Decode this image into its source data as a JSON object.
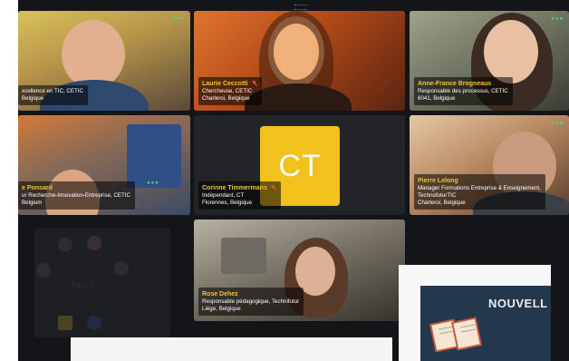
{
  "tiles": [
    {
      "name_label": "",
      "line1": "xcellence en TIC, CETIC",
      "line2": "Belgique"
    },
    {
      "name_label": "Laurie Ceccotti",
      "line1": "Chercheuse, CETIC",
      "line2": "Charleroi, Belgique"
    },
    {
      "name_label": "Anne-France Brogneaux",
      "line1": "Responsable des processus, CETIC",
      "line2": "6041, Belgique"
    },
    {
      "name_label": "e Ponsard",
      "line1": "ur Recherche-Innovation-Entreprise, CETIC",
      "line2": "Belgium"
    },
    {
      "name_label": "Corinne Timmermans",
      "line1": "Indépendant, CT",
      "line2": "Florennes, Belgique",
      "avatar": "CT"
    },
    {
      "name_label": "Pierre Lelong",
      "line1": "Manager Formations Entreprise & Enseignement,",
      "line2": "TechnofuturTIC",
      "line3": "Charleroi, Belgique"
    },
    {
      "name_label": "Rose Dehez",
      "line1": "Responsable pédagogique, Technifutur",
      "line2": "Liège, Belgique"
    }
  ],
  "background": {
    "table_label": "Table 1"
  },
  "slide": {
    "title": "NOUVELL"
  },
  "colors": {
    "accent_name": "#f0c431",
    "avatar_bg": "#f1c21b",
    "speaking": "#3ce08a",
    "muted_mic": "#e05a4a"
  },
  "icons": {
    "mic_muted": "mic-muted-icon",
    "audio_indicator": "audio-dots-icon"
  }
}
